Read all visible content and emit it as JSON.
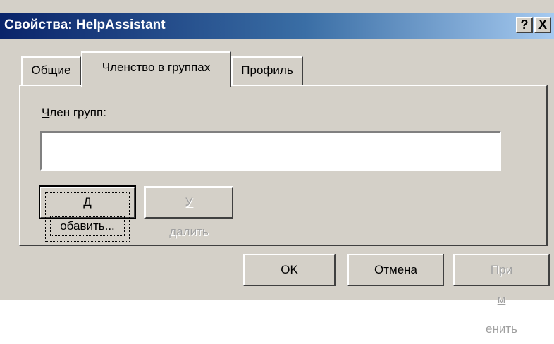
{
  "window": {
    "title": "Свойства: HelpAssistant",
    "help_glyph": "?",
    "close_glyph": "X"
  },
  "tabs": [
    {
      "label": "Общие",
      "active": false
    },
    {
      "label": "Членство в группах",
      "active": true
    },
    {
      "label": "Профиль",
      "active": false
    }
  ],
  "membership": {
    "label_accel": "Ч",
    "label_rest": "лен групп:",
    "groups": []
  },
  "buttons": {
    "add_accel": "Д",
    "add_rest": "обавить...",
    "remove_accel": "У",
    "remove_rest": "далить",
    "ok": "OK",
    "cancel": "Отмена",
    "apply_pre": "При",
    "apply_accel": "м",
    "apply_post": "енить"
  },
  "colors": {
    "face": "#d4d0c8",
    "title_start": "#0a246a",
    "title_end": "#a6caf0",
    "disabled_text": "#a0a0a0"
  }
}
